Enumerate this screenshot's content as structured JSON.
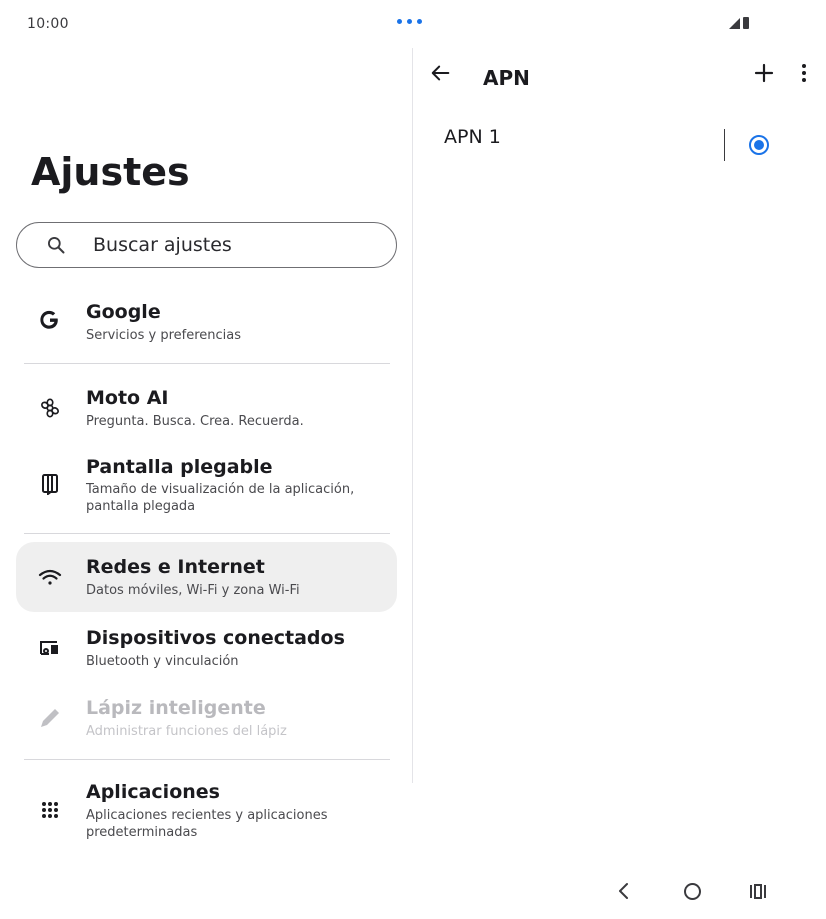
{
  "status_bar": {
    "time": "10:00",
    "indicator_color": "#1a73e8",
    "icons": [
      "signal-icon",
      "battery-icon"
    ]
  },
  "settings": {
    "title": "Ajustes",
    "search_placeholder": "Buscar ajustes",
    "items": [
      {
        "icon": "google-icon",
        "title": "Google",
        "subtitle": "Servicios y preferencias"
      },
      {
        "icon": "moto-ai-icon",
        "title": "Moto AI",
        "subtitle": "Pregunta. Busca. Crea. Recuerda."
      },
      {
        "icon": "foldable-screen-icon",
        "title": "Pantalla plegable",
        "subtitle": "Tamaño de visualización de la aplicación, pantalla plegada"
      },
      {
        "icon": "wifi-icon",
        "title": "Redes e Internet",
        "subtitle": "Datos móviles, Wi-Fi y zona Wi-Fi",
        "selected": true
      },
      {
        "icon": "connected-devices-icon",
        "title": "Dispositivos conectados",
        "subtitle": "Bluetooth y vinculación"
      },
      {
        "icon": "pen-icon",
        "title": "Lápiz inteligente",
        "subtitle": "Administrar funciones del lápiz",
        "disabled": true
      },
      {
        "icon": "apps-grid-icon",
        "title": "Aplicaciones",
        "subtitle": "Aplicaciones recientes y aplicaciones predeterminadas"
      }
    ]
  },
  "apn": {
    "title": "APN",
    "entries": [
      {
        "name": "APN 1",
        "selected": true
      }
    ],
    "accent_color": "#1a73e8"
  },
  "nav_bar": {
    "icons": [
      "nav-back-icon",
      "nav-home-icon",
      "nav-recents-icon"
    ]
  }
}
